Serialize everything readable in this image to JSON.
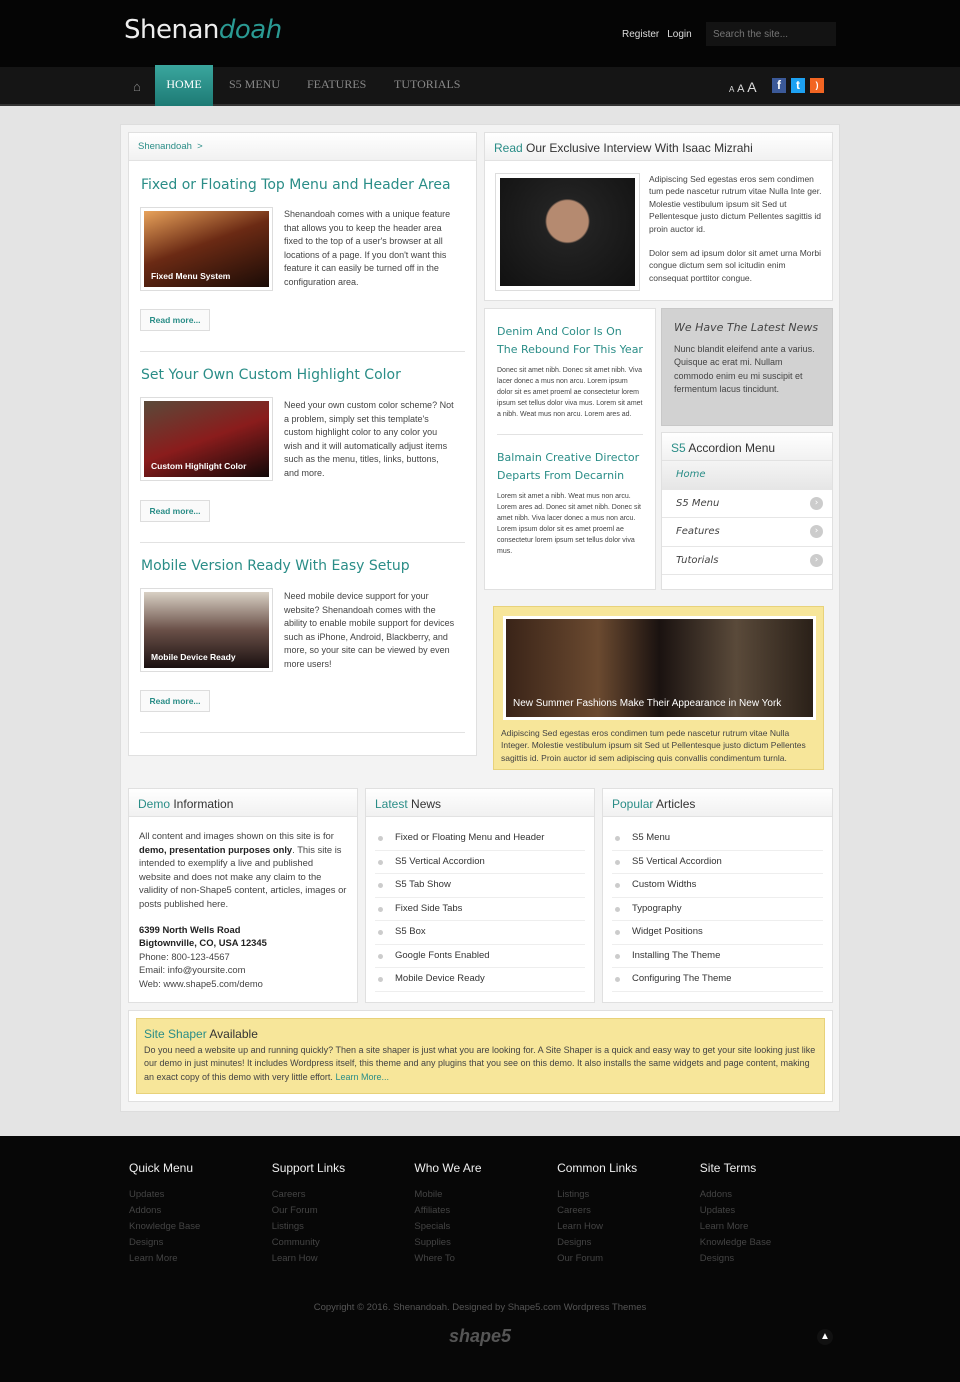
{
  "header": {
    "logo_main": "Shenan",
    "logo_accent": "doah",
    "register": "Register",
    "login": "Login",
    "search_placeholder": "Search the site..."
  },
  "nav": {
    "items": [
      "HOME",
      "S5 MENU",
      "FEATURES",
      "TUTORIALS"
    ],
    "text_size": [
      "A",
      "A",
      "A"
    ],
    "social": [
      "facebook-icon",
      "twitter-icon",
      "rss-icon"
    ]
  },
  "colors": {
    "accent": "#2a8d87",
    "highlight_box": "#f7e69a"
  },
  "breadcrumb": {
    "home": "Shenandoah",
    "sep": ">"
  },
  "articles": [
    {
      "title": "Fixed or Floating Top Menu and Header Area",
      "caption": "Fixed Menu System",
      "text": "Shenandoah comes with a unique feature that allows you to keep the header area fixed to the top of a user's browser at all locations of a page. If you don't want this feature it can easily be turned off in the configuration area.",
      "more": "Read more..."
    },
    {
      "title": "Set Your Own Custom Highlight Color",
      "caption": "Custom Highlight Color",
      "text": "Need your own custom color scheme? Not a problem, simply set this template's custom highlight color to any color you wish and it will automatically adjust items such as the menu, titles, links, buttons, and more.",
      "more": "Read more..."
    },
    {
      "title": "Mobile Version Ready With Easy Setup",
      "caption": "Mobile Device Ready",
      "text": "Need mobile device support for your website? Shenandoah comes with the ability to enable mobile support for devices such as iPhone, Android, Blackberry, and more, so your site can be viewed by even more users!",
      "more": "Read more..."
    }
  ],
  "interview": {
    "accent": "Read",
    "title": " Our Exclusive Interview With Isaac Mizrahi",
    "p1": "Adipiscing Sed egestas eros sem condimen tum pede nascetur rutrum vitae Nulla Inte ger. Molestie vestibulum ipsum sit Sed ut Pellentesque justo dictum Pellentes sagittis id proin auctor id.",
    "p2": "Dolor sem ad ipsum dolor sit amet urna Morbi congue dictum sem sol icitudin enim consequat porttitor congue."
  },
  "news_mid": [
    {
      "title": "Denim And Color Is On The Rebound For This Year",
      "text": "Donec sit amet nibh. Donec sit amet nibh. Viva lacer donec a mus non arcu. Lorem ipsum dolor sit es amet proeml ae consectetur lorem ipsum set tellus dolor viva mus. Lorem sit amet a nibh. Weat mus non arcu. Lorem ares ad."
    },
    {
      "title": "Balmain Creative Director Departs From Decarnin",
      "text": "Lorem sit amet a nibh. Weat mus non arcu. Lorem ares ad. Donec sit amet nibh. Donec sit amet nibh. Viva lacer donec a mus non arcu. Lorem ipsum dolor sit es amet proeml ae consectetur lorem ipsum set tellus dolor viva mus."
    }
  ],
  "latest_box": {
    "title": "We Have The Latest News",
    "text": "Nunc blandit eleifend ante a varius. Quisque ac erat mi. Nullam commodo enim eu mi suscipit et fermentum lacus tincidunt."
  },
  "accordion": {
    "accent": "S5",
    "title": " Accordion Menu",
    "items": [
      "Home",
      "S5 Menu",
      "Features",
      "Tutorials"
    ]
  },
  "feature": {
    "caption": "New Summer Fashions Make Their Appearance in New York",
    "text": "Adipiscing Sed egestas eros condimen tum pede nascetur rutrum vitae Nulla Integer. Molestie vestibulum ipsum sit Sed ut Pellentesque justo dictum Pellentes sagittis id. Proin auctor id sem adipiscing quis convallis condimentum turnla."
  },
  "demo": {
    "accent": "Demo",
    "title": " Information",
    "t1": "All content and images shown on this site is for ",
    "bold": "demo, presentation purposes only",
    "t2": ". This site is intended to exemplify a live and published website and does not make any claim to the validity of non-Shape5 content, articles, images or posts published here.",
    "addr1": "6399 North Wells Road",
    "addr2": "Bigtownville, CO, USA 12345",
    "phone": "Phone: 800-123-4567",
    "email": "Email: info@yoursite.com",
    "web": "Web: www.shape5.com/demo"
  },
  "latest": {
    "accent": "Latest",
    "title": " News",
    "items": [
      "Fixed or Floating Menu and Header",
      "S5 Vertical Accordion",
      "S5 Tab Show",
      "Fixed Side Tabs",
      "S5 Box",
      "Google Fonts Enabled",
      "Mobile Device Ready"
    ]
  },
  "popular": {
    "accent": "Popular",
    "title": " Articles",
    "items": [
      "S5 Menu",
      "S5 Vertical Accordion",
      "Custom Widths",
      "Typography",
      "Widget Positions",
      "Installing The Theme",
      "Configuring The Theme"
    ]
  },
  "shaper": {
    "accent": "Site Shaper",
    "title": " Available",
    "text": "Do you need a website up and running quickly? Then a site shaper is just what you are looking for. A Site Shaper is a quick and easy way to get your site looking just like our demo in just minutes! It includes Wordpress itself, this theme and any plugins that you see on this demo. It also installs the same widgets and page content, making an exact copy of this demo with very little effort.",
    "link": "Learn More..."
  },
  "footer": {
    "columns": [
      {
        "title": "Quick Menu",
        "links": [
          "Updates",
          "Addons",
          "Knowledge Base",
          "Designs",
          "Learn More"
        ]
      },
      {
        "title": "Support Links",
        "links": [
          "Careers",
          "Our Forum",
          "Listings",
          "Community",
          "Learn How"
        ]
      },
      {
        "title": "Who We Are",
        "links": [
          "Mobile",
          "Affiliates",
          "Specials",
          "Supplies",
          "Where To"
        ]
      },
      {
        "title": "Common Links",
        "links": [
          "Listings",
          "Careers",
          "Learn How",
          "Designs",
          "Our Forum"
        ]
      },
      {
        "title": "Site Terms",
        "links": [
          "Addons",
          "Updates",
          "Learn More",
          "Knowledge Base",
          "Designs"
        ]
      }
    ],
    "copyright": "Copyright © 2016. Shenandoah. Designed by Shape5.com Wordpress Themes",
    "logo": "shape5"
  }
}
